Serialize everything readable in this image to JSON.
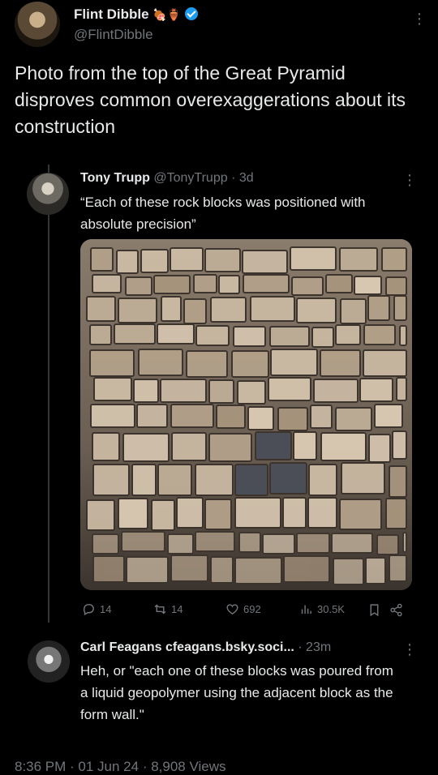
{
  "post": {
    "author_name": "Flint Dibble",
    "author_emoji": "🍖🏺",
    "author_handle": "@FlintDibble",
    "text": "Photo from the top of the Great Pyramid disproves common overexaggerations about its construction"
  },
  "quoted": {
    "author_name": "Tony Trupp",
    "author_handle": "@TonyTrupp",
    "age": "· 3d",
    "text": "“Each of these rock blocks was positioned with absolute precision”"
  },
  "stats": {
    "replies": "14",
    "reposts": "14",
    "likes": "692",
    "views": "30.5K"
  },
  "reply": {
    "author_name": "Carl Feagans",
    "author_handle": "cfeagans.bsky.soci...",
    "age": "· 23m",
    "text": "Heh, or \"each one of these blocks was poured from a liquid geopolymer using the adjacent block as the form wall.\""
  },
  "footer": {
    "meta": "8:36 PM · 01 Jun 24 · 8,908 Views"
  },
  "icons": {
    "kebab": "⋮",
    "reply": "reply-icon",
    "repost": "repost-icon",
    "like": "heart-icon",
    "views": "views-icon",
    "bookmark": "bookmark-icon",
    "share": "share-icon"
  },
  "colors": {
    "background": "#000000",
    "text": "#e7e9ea",
    "muted": "#71767b",
    "verified": "#1d9bf0"
  }
}
